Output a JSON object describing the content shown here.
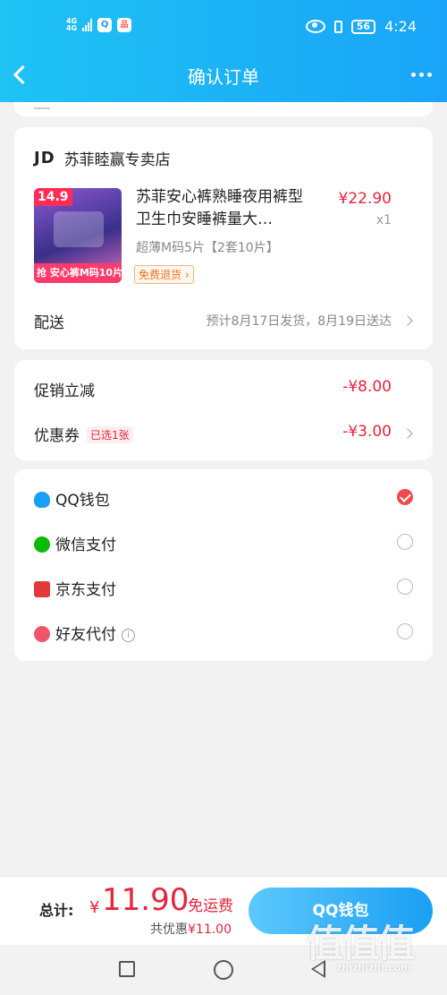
{
  "status_bar": {
    "network": "4G",
    "network2": "4G",
    "app1": "Q",
    "app2": "品",
    "battery": "56",
    "time": "4:24"
  },
  "nav": {
    "title": "确认订单"
  },
  "order": {
    "shop_prefix": "JD",
    "shop_name": "苏菲睦赢专卖店",
    "product_name": "苏菲安心裤熟睡夜用裤型卫生巾安睡裤量大…",
    "price": "¥22.90",
    "qty": "x1",
    "spec": "超薄M码5片【2套10片】",
    "tag": "免费退货",
    "thumb": {
      "badge": "14.9",
      "banner": "抢 安心裤M码10片"
    },
    "shipping_label": "配送",
    "shipping_info": "预计8月17日发货，8月19日送达"
  },
  "discounts": {
    "promo_label": "促销立减",
    "promo_amount": "-¥8.00",
    "coupon_label": "优惠券",
    "coupon_tag": "已选1张",
    "coupon_amount": "-¥3.00"
  },
  "payment": {
    "options": [
      {
        "label": "QQ钱包",
        "selected": true,
        "icon": "qq-penguin-icon",
        "color": "#1a9ff4"
      },
      {
        "label": "微信支付",
        "selected": false,
        "icon": "wechat-icon",
        "color": "#09bb07"
      },
      {
        "label": "京东支付",
        "selected": false,
        "icon": "jd-pay-icon",
        "color": "#e4393c"
      },
      {
        "label": "好友代付",
        "selected": false,
        "icon": "heart-icon",
        "color": "#f0566a"
      }
    ],
    "info_glyph": "i"
  },
  "footer": {
    "total_label": "总计:",
    "currency": "¥",
    "total": "11.90",
    "free_shipping": "免运费",
    "saved_label": "共优惠",
    "saved_amount": "¥11.00",
    "pay_button": "QQ钱包"
  },
  "watermark": {
    "text": "值值值",
    "sub": "zhizhizhi.com"
  },
  "colors": {
    "accent": "#1a9ff4",
    "price_red": "#e6243b"
  }
}
